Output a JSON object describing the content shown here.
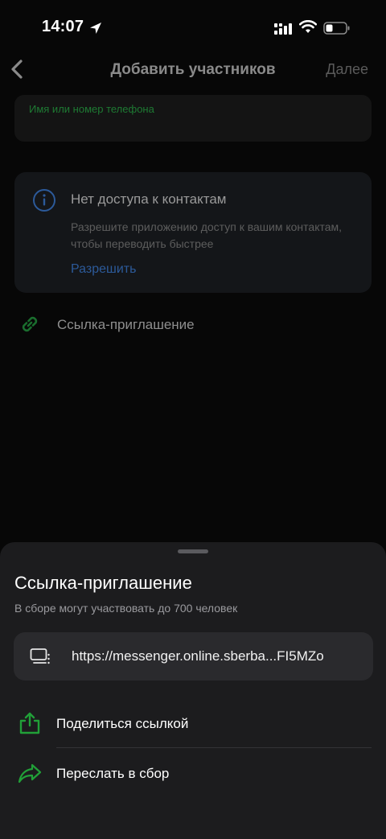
{
  "status_bar": {
    "time": "14:07"
  },
  "nav": {
    "title": "Добавить участников",
    "next_label": "Далее"
  },
  "search": {
    "placeholder": "Имя или номер телефона"
  },
  "contacts_card": {
    "title": "Нет доступа к контактам",
    "text": "Разрешите приложению доступ к вашим контактам, чтобы переводить быстрее",
    "allow_label": "Разрешить"
  },
  "invite_row": {
    "label": "Ссылка-приглашение"
  },
  "sheet": {
    "title": "Ссылка-приглашение",
    "subtitle": "В сборе могут участвовать до 700 человек",
    "url": "https://messenger.online.sberba...FI5MZo",
    "actions": [
      {
        "label": "Поделиться ссылкой",
        "icon": "share-icon"
      },
      {
        "label": "Переслать в сбор",
        "icon": "forward-icon"
      }
    ]
  },
  "colors": {
    "accent_green": "#21a038",
    "link_blue": "#2c5a9a"
  }
}
